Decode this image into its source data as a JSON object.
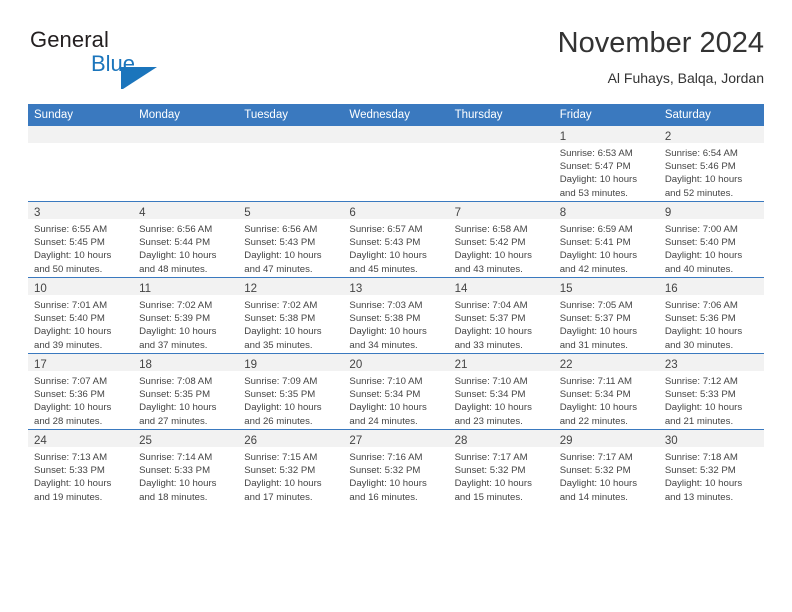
{
  "brand": {
    "line1": "General",
    "line2": "Blue",
    "flag_icon": "blue-triangle-flag",
    "accent_color": "#1b75bc"
  },
  "header": {
    "title": "November 2024",
    "subtitle": "Al Fuhays, Balqa, Jordan"
  },
  "colors": {
    "header_blue": "#3a79bf",
    "daynum_band": "#f2f2f2",
    "text": "#444444"
  },
  "weekdays": [
    "Sunday",
    "Monday",
    "Tuesday",
    "Wednesday",
    "Thursday",
    "Friday",
    "Saturday"
  ],
  "labels": {
    "sunrise": "Sunrise:",
    "sunset": "Sunset:",
    "daylight": "Daylight:"
  },
  "weeks": [
    [
      {
        "day": "",
        "sunrise": "",
        "sunset": "",
        "daylight1": "",
        "daylight2": ""
      },
      {
        "day": "",
        "sunrise": "",
        "sunset": "",
        "daylight1": "",
        "daylight2": ""
      },
      {
        "day": "",
        "sunrise": "",
        "sunset": "",
        "daylight1": "",
        "daylight2": ""
      },
      {
        "day": "",
        "sunrise": "",
        "sunset": "",
        "daylight1": "",
        "daylight2": ""
      },
      {
        "day": "",
        "sunrise": "",
        "sunset": "",
        "daylight1": "",
        "daylight2": ""
      },
      {
        "day": "1",
        "sunrise": "Sunrise: 6:53 AM",
        "sunset": "Sunset: 5:47 PM",
        "daylight1": "Daylight: 10 hours",
        "daylight2": "and 53 minutes."
      },
      {
        "day": "2",
        "sunrise": "Sunrise: 6:54 AM",
        "sunset": "Sunset: 5:46 PM",
        "daylight1": "Daylight: 10 hours",
        "daylight2": "and 52 minutes."
      }
    ],
    [
      {
        "day": "3",
        "sunrise": "Sunrise: 6:55 AM",
        "sunset": "Sunset: 5:45 PM",
        "daylight1": "Daylight: 10 hours",
        "daylight2": "and 50 minutes."
      },
      {
        "day": "4",
        "sunrise": "Sunrise: 6:56 AM",
        "sunset": "Sunset: 5:44 PM",
        "daylight1": "Daylight: 10 hours",
        "daylight2": "and 48 minutes."
      },
      {
        "day": "5",
        "sunrise": "Sunrise: 6:56 AM",
        "sunset": "Sunset: 5:43 PM",
        "daylight1": "Daylight: 10 hours",
        "daylight2": "and 47 minutes."
      },
      {
        "day": "6",
        "sunrise": "Sunrise: 6:57 AM",
        "sunset": "Sunset: 5:43 PM",
        "daylight1": "Daylight: 10 hours",
        "daylight2": "and 45 minutes."
      },
      {
        "day": "7",
        "sunrise": "Sunrise: 6:58 AM",
        "sunset": "Sunset: 5:42 PM",
        "daylight1": "Daylight: 10 hours",
        "daylight2": "and 43 minutes."
      },
      {
        "day": "8",
        "sunrise": "Sunrise: 6:59 AM",
        "sunset": "Sunset: 5:41 PM",
        "daylight1": "Daylight: 10 hours",
        "daylight2": "and 42 minutes."
      },
      {
        "day": "9",
        "sunrise": "Sunrise: 7:00 AM",
        "sunset": "Sunset: 5:40 PM",
        "daylight1": "Daylight: 10 hours",
        "daylight2": "and 40 minutes."
      }
    ],
    [
      {
        "day": "10",
        "sunrise": "Sunrise: 7:01 AM",
        "sunset": "Sunset: 5:40 PM",
        "daylight1": "Daylight: 10 hours",
        "daylight2": "and 39 minutes."
      },
      {
        "day": "11",
        "sunrise": "Sunrise: 7:02 AM",
        "sunset": "Sunset: 5:39 PM",
        "daylight1": "Daylight: 10 hours",
        "daylight2": "and 37 minutes."
      },
      {
        "day": "12",
        "sunrise": "Sunrise: 7:02 AM",
        "sunset": "Sunset: 5:38 PM",
        "daylight1": "Daylight: 10 hours",
        "daylight2": "and 35 minutes."
      },
      {
        "day": "13",
        "sunrise": "Sunrise: 7:03 AM",
        "sunset": "Sunset: 5:38 PM",
        "daylight1": "Daylight: 10 hours",
        "daylight2": "and 34 minutes."
      },
      {
        "day": "14",
        "sunrise": "Sunrise: 7:04 AM",
        "sunset": "Sunset: 5:37 PM",
        "daylight1": "Daylight: 10 hours",
        "daylight2": "and 33 minutes."
      },
      {
        "day": "15",
        "sunrise": "Sunrise: 7:05 AM",
        "sunset": "Sunset: 5:37 PM",
        "daylight1": "Daylight: 10 hours",
        "daylight2": "and 31 minutes."
      },
      {
        "day": "16",
        "sunrise": "Sunrise: 7:06 AM",
        "sunset": "Sunset: 5:36 PM",
        "daylight1": "Daylight: 10 hours",
        "daylight2": "and 30 minutes."
      }
    ],
    [
      {
        "day": "17",
        "sunrise": "Sunrise: 7:07 AM",
        "sunset": "Sunset: 5:36 PM",
        "daylight1": "Daylight: 10 hours",
        "daylight2": "and 28 minutes."
      },
      {
        "day": "18",
        "sunrise": "Sunrise: 7:08 AM",
        "sunset": "Sunset: 5:35 PM",
        "daylight1": "Daylight: 10 hours",
        "daylight2": "and 27 minutes."
      },
      {
        "day": "19",
        "sunrise": "Sunrise: 7:09 AM",
        "sunset": "Sunset: 5:35 PM",
        "daylight1": "Daylight: 10 hours",
        "daylight2": "and 26 minutes."
      },
      {
        "day": "20",
        "sunrise": "Sunrise: 7:10 AM",
        "sunset": "Sunset: 5:34 PM",
        "daylight1": "Daylight: 10 hours",
        "daylight2": "and 24 minutes."
      },
      {
        "day": "21",
        "sunrise": "Sunrise: 7:10 AM",
        "sunset": "Sunset: 5:34 PM",
        "daylight1": "Daylight: 10 hours",
        "daylight2": "and 23 minutes."
      },
      {
        "day": "22",
        "sunrise": "Sunrise: 7:11 AM",
        "sunset": "Sunset: 5:34 PM",
        "daylight1": "Daylight: 10 hours",
        "daylight2": "and 22 minutes."
      },
      {
        "day": "23",
        "sunrise": "Sunrise: 7:12 AM",
        "sunset": "Sunset: 5:33 PM",
        "daylight1": "Daylight: 10 hours",
        "daylight2": "and 21 minutes."
      }
    ],
    [
      {
        "day": "24",
        "sunrise": "Sunrise: 7:13 AM",
        "sunset": "Sunset: 5:33 PM",
        "daylight1": "Daylight: 10 hours",
        "daylight2": "and 19 minutes."
      },
      {
        "day": "25",
        "sunrise": "Sunrise: 7:14 AM",
        "sunset": "Sunset: 5:33 PM",
        "daylight1": "Daylight: 10 hours",
        "daylight2": "and 18 minutes."
      },
      {
        "day": "26",
        "sunrise": "Sunrise: 7:15 AM",
        "sunset": "Sunset: 5:32 PM",
        "daylight1": "Daylight: 10 hours",
        "daylight2": "and 17 minutes."
      },
      {
        "day": "27",
        "sunrise": "Sunrise: 7:16 AM",
        "sunset": "Sunset: 5:32 PM",
        "daylight1": "Daylight: 10 hours",
        "daylight2": "and 16 minutes."
      },
      {
        "day": "28",
        "sunrise": "Sunrise: 7:17 AM",
        "sunset": "Sunset: 5:32 PM",
        "daylight1": "Daylight: 10 hours",
        "daylight2": "and 15 minutes."
      },
      {
        "day": "29",
        "sunrise": "Sunrise: 7:17 AM",
        "sunset": "Sunset: 5:32 PM",
        "daylight1": "Daylight: 10 hours",
        "daylight2": "and 14 minutes."
      },
      {
        "day": "30",
        "sunrise": "Sunrise: 7:18 AM",
        "sunset": "Sunset: 5:32 PM",
        "daylight1": "Daylight: 10 hours",
        "daylight2": "and 13 minutes."
      }
    ]
  ]
}
